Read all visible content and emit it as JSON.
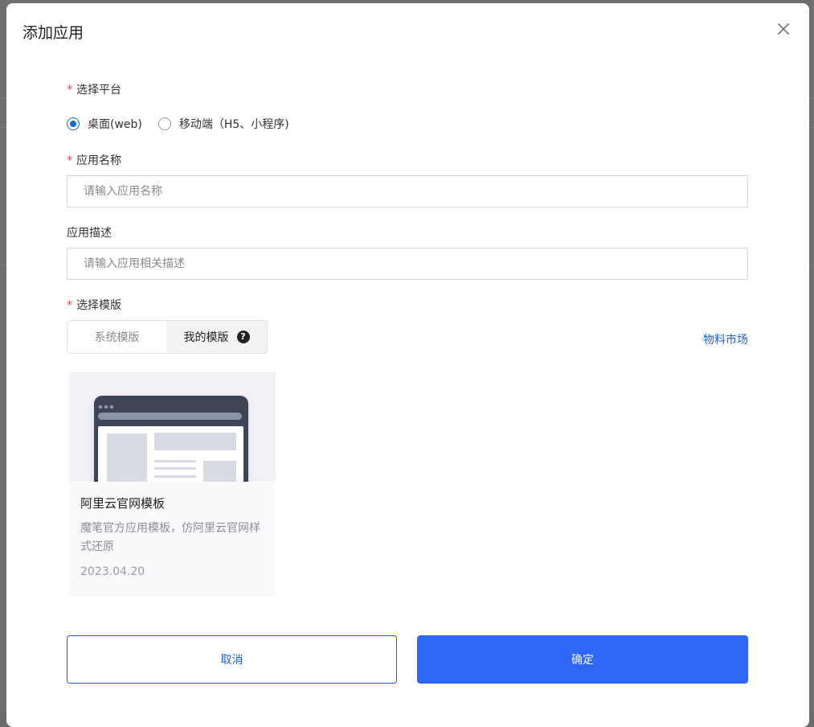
{
  "dialog": {
    "title": "添加应用",
    "close_icon": "close-icon"
  },
  "platform": {
    "label": "选择平台",
    "required_mark": "*",
    "options": [
      {
        "label": "桌面(web)",
        "checked": true
      },
      {
        "label": "移动端（H5、小程序)",
        "checked": false
      }
    ]
  },
  "app_name": {
    "label": "应用名称",
    "required_mark": "*",
    "value": "",
    "placeholder": "请输入应用名称"
  },
  "app_desc": {
    "label": "应用描述",
    "value": "",
    "placeholder": "请输入应用相关描述"
  },
  "template": {
    "label": "选择模版",
    "required_mark": "*",
    "tabs": [
      {
        "label": "系统模版",
        "active": false
      },
      {
        "label": "我的模版",
        "active": true
      }
    ],
    "help_icon": "question-circle-icon",
    "help_glyph": "?",
    "market_link": "物料市场",
    "cards": [
      {
        "title": "阿里云官网模板",
        "description": "魔笔官方应用模板，仿阿里云官网样式还原",
        "date": "2023.04.20"
      }
    ]
  },
  "footer": {
    "cancel_label": "取消",
    "ok_label": "确定"
  },
  "colors": {
    "primary": "#2e66f6",
    "link": "#1f62d6",
    "required": "#e5484d",
    "radio_checked": "#0d6edc"
  }
}
